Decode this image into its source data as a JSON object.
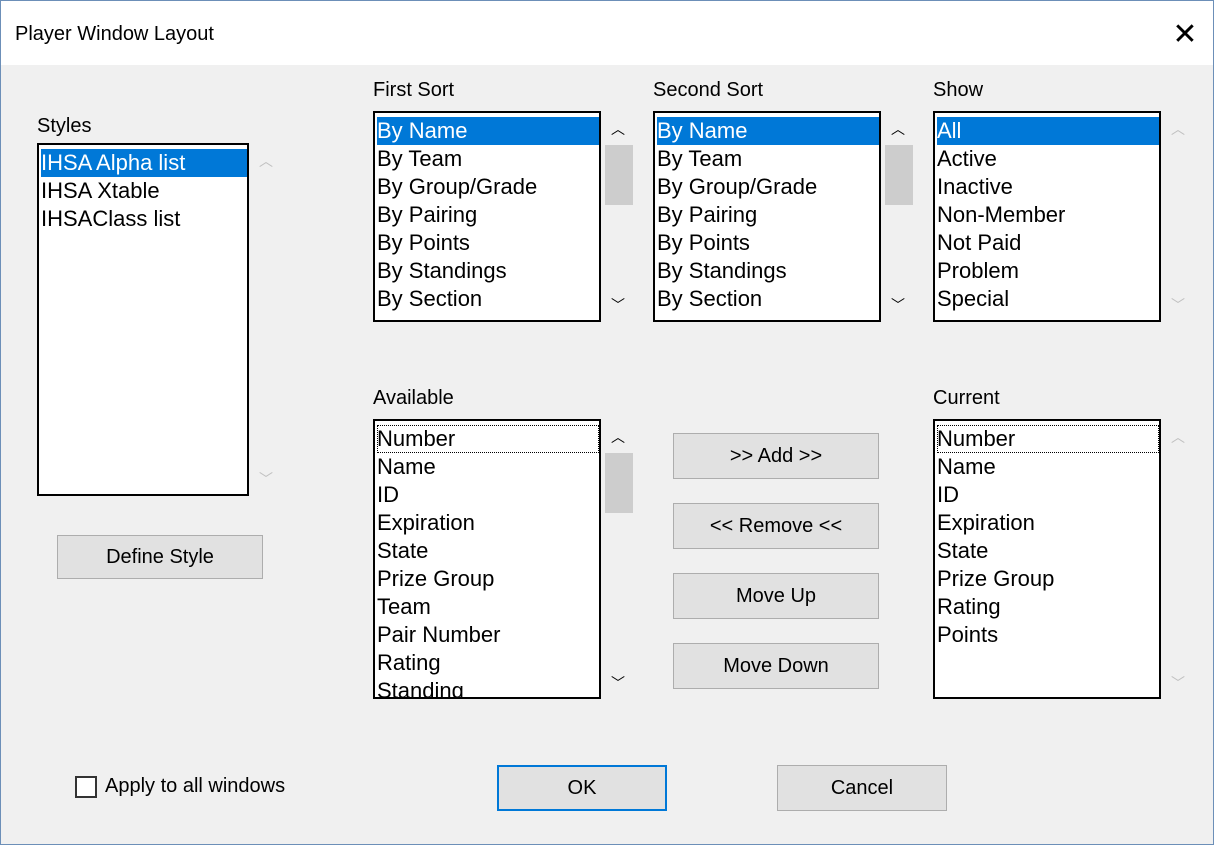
{
  "window": {
    "title": "Player Window Layout",
    "close_glyph": "✕"
  },
  "styles": {
    "label": "Styles",
    "items": [
      "IHSA Alpha list",
      "IHSA Xtable",
      "IHSAClass list"
    ],
    "selected": "IHSA Alpha list"
  },
  "define_style_label": "Define Style",
  "first_sort": {
    "label": "First Sort",
    "items": [
      "By Name",
      "By Team",
      "By Group/Grade",
      "By Pairing",
      "By Points",
      "By Standings",
      "By Section"
    ],
    "selected": "By Name"
  },
  "second_sort": {
    "label": "Second Sort",
    "items": [
      "By Name",
      "By Team",
      "By Group/Grade",
      "By Pairing",
      "By Points",
      "By Standings",
      "By Section"
    ],
    "selected": "By Name"
  },
  "show": {
    "label": "Show",
    "items": [
      "All",
      "Active",
      "Inactive",
      "Non-Member",
      "Not Paid",
      "Problem",
      "Special"
    ],
    "selected": "All"
  },
  "available": {
    "label": "Available",
    "items": [
      "Number",
      "Name",
      "ID",
      "Expiration",
      "State",
      "Prize Group",
      "Team",
      "Pair Number",
      "Rating",
      "Standing"
    ],
    "focused": "Number"
  },
  "current": {
    "label": "Current",
    "items": [
      "Number",
      "Name",
      "ID",
      "Expiration",
      "State",
      "Prize Group",
      "Rating",
      "Points"
    ],
    "focused": "Number"
  },
  "buttons": {
    "add": ">> Add >>",
    "remove": "<< Remove <<",
    "move_up": "Move Up",
    "move_down": "Move Down",
    "ok": "OK",
    "cancel": "Cancel"
  },
  "apply_all": {
    "label": "Apply to all windows",
    "checked": false
  },
  "colors": {
    "selection": "#0078d7",
    "background": "#f0f0f0",
    "border": "#6c8fb8"
  }
}
